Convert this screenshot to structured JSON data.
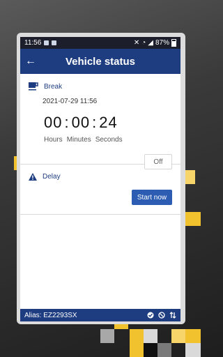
{
  "status_bar": {
    "time": "11:56",
    "battery": "87%"
  },
  "app_bar": {
    "title": "Vehicle status",
    "back_icon": "arrow-left-icon"
  },
  "break_section": {
    "label": "Break",
    "icon": "coffee-cup-icon",
    "datetime": "2021-07-29 11:56",
    "hours": "00",
    "minutes": "00",
    "seconds": "24",
    "separator": ":",
    "hours_label": "Hours",
    "minutes_label": "Minutes",
    "seconds_label": "Seconds",
    "off_button": "Off"
  },
  "delay_section": {
    "label": "Delay",
    "icon": "warning-icon",
    "start_button": "Start now"
  },
  "footer": {
    "alias": "Alias: EZ2293SX",
    "icons": [
      "check-circle-icon",
      "blocked-icon",
      "sync-arrows-icon"
    ]
  },
  "colors": {
    "primary": "#1e3c80",
    "button": "#2c5db3",
    "accent": "#f2c12e"
  }
}
